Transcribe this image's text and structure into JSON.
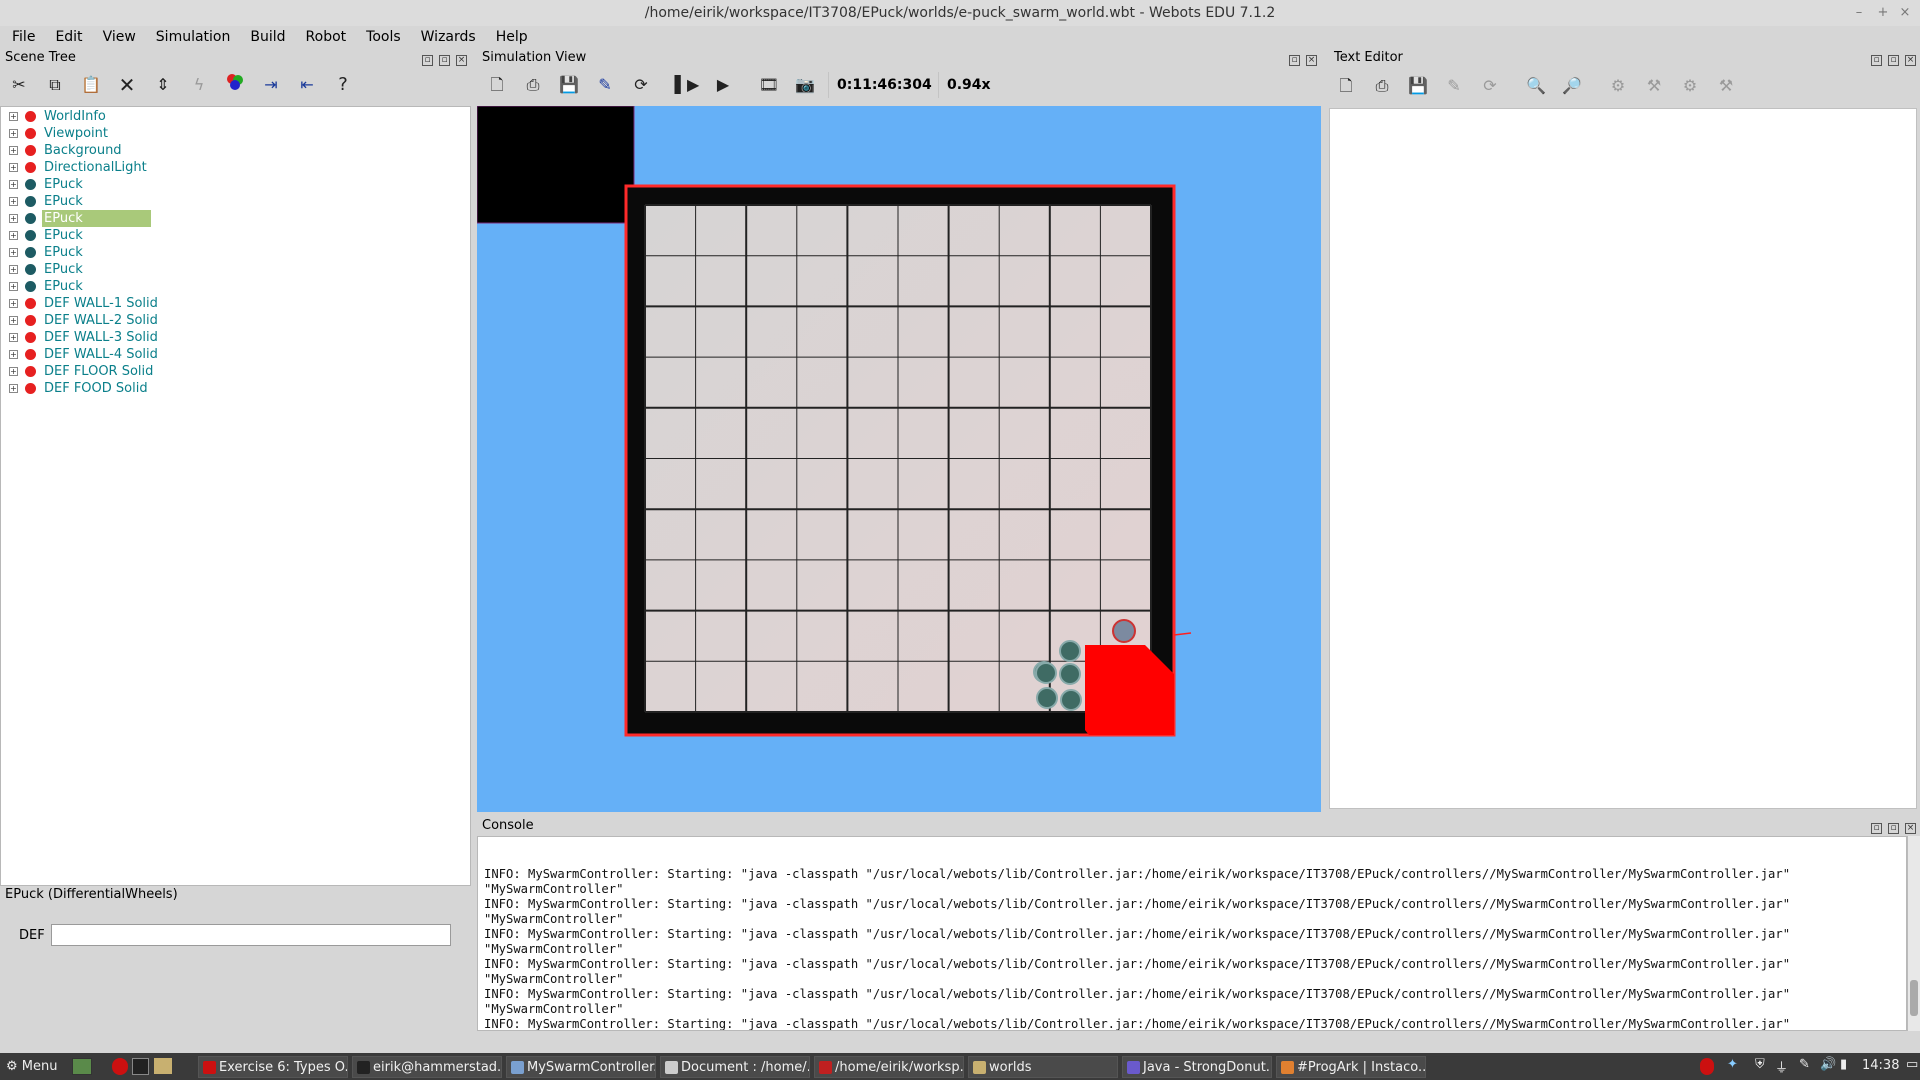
{
  "window": {
    "title": "/home/eirik/workspace/IT3708/EPuck/worlds/e-puck_swarm_world.wbt - Webots EDU 7.1.2"
  },
  "menubar": [
    "File",
    "Edit",
    "View",
    "Simulation",
    "Build",
    "Robot",
    "Tools",
    "Wizards",
    "Help"
  ],
  "scene_tree": {
    "title": "Scene Tree",
    "toolbar_icons": [
      "cut-icon",
      "copy-icon",
      "paste-icon",
      "delete-icon",
      "reset-value-icon",
      "transform-icon",
      "add-node-icon",
      "import-icon",
      "export-icon",
      "help-icon"
    ],
    "help_glyph": "?",
    "items": [
      {
        "label": "WorldInfo",
        "dot": "#e62020"
      },
      {
        "label": "Viewpoint",
        "dot": "#e62020"
      },
      {
        "label": "Background",
        "dot": "#e62020"
      },
      {
        "label": "DirectionalLight",
        "dot": "#e62020"
      },
      {
        "label": "EPuck",
        "dot": "#1d5b63"
      },
      {
        "label": "EPuck",
        "dot": "#1d5b63"
      },
      {
        "label": "EPuck",
        "dot": "#1d5b63",
        "selected": true
      },
      {
        "label": "EPuck",
        "dot": "#1d5b63"
      },
      {
        "label": "EPuck",
        "dot": "#1d5b63"
      },
      {
        "label": "EPuck",
        "dot": "#1d5b63"
      },
      {
        "label": "EPuck",
        "dot": "#1d5b63"
      },
      {
        "label": "DEF WALL-1 Solid",
        "dot": "#e62020"
      },
      {
        "label": "DEF WALL-2 Solid",
        "dot": "#e62020"
      },
      {
        "label": "DEF WALL-3 Solid",
        "dot": "#e62020"
      },
      {
        "label": "DEF WALL-4 Solid",
        "dot": "#e62020"
      },
      {
        "label": "DEF FLOOR Solid",
        "dot": "#e62020"
      },
      {
        "label": "DEF FOOD Solid",
        "dot": "#e62020"
      }
    ],
    "selection_label": "EPuck (DifferentialWheels)",
    "def_label": "DEF",
    "def_value": ""
  },
  "simulation_view": {
    "title": "Simulation View",
    "toolbar_icons": [
      "new-world-icon",
      "open-world-icon",
      "save-world-icon",
      "edit-icon",
      "reload-icon",
      "step-icon",
      "run-icon",
      "record-movie-icon",
      "screenshot-icon"
    ],
    "time": "0:11:46:304",
    "speed": "0.94x",
    "grid": {
      "cols": 10,
      "rows": 10
    },
    "colors": {
      "background": "#65b0f7",
      "wall": "#0a0a0a",
      "food": "#ff0000",
      "floor": "#d4d2d2",
      "wall_edge": "#ff2a2a"
    }
  },
  "text_editor": {
    "title": "Text Editor",
    "toolbar_icons": [
      "new-file-icon",
      "open-file-icon",
      "save-file-icon",
      "save-as-icon",
      "revert-icon",
      "find-icon",
      "replace-icon",
      "build-icon",
      "clean-icon",
      "make-icon",
      "broom-icon"
    ]
  },
  "console": {
    "title": "Console",
    "lines": [
      "INFO: MySwarmController: Starting: \"java -classpath \"/usr/local/webots/lib/Controller.jar:/home/eirik/workspace/IT3708/EPuck/controllers//MySwarmController/MySwarmController.jar\"",
      "\"MySwarmController\"",
      "INFO: MySwarmController: Starting: \"java -classpath \"/usr/local/webots/lib/Controller.jar:/home/eirik/workspace/IT3708/EPuck/controllers//MySwarmController/MySwarmController.jar\"",
      "\"MySwarmController\"",
      "INFO: MySwarmController: Starting: \"java -classpath \"/usr/local/webots/lib/Controller.jar:/home/eirik/workspace/IT3708/EPuck/controllers//MySwarmController/MySwarmController.jar\"",
      "\"MySwarmController\"",
      "INFO: MySwarmController: Starting: \"java -classpath \"/usr/local/webots/lib/Controller.jar:/home/eirik/workspace/IT3708/EPuck/controllers//MySwarmController/MySwarmController.jar\"",
      "\"MySwarmController\"",
      "INFO: MySwarmController: Starting: \"java -classpath \"/usr/local/webots/lib/Controller.jar:/home/eirik/workspace/IT3708/EPuck/controllers//MySwarmController/MySwarmController.jar\"",
      "\"MySwarmController\"",
      "INFO: MySwarmController: Starting: \"java -classpath \"/usr/local/webots/lib/Controller.jar:/home/eirik/workspace/IT3708/EPuck/controllers//MySwarmController/MySwarmController.jar\"",
      "\"MySwarmController\""
    ]
  },
  "taskbar": {
    "menu_label": "Menu",
    "tasks": [
      {
        "label": "Exercise 6: Types O...",
        "color": "#cc1010",
        "icon": "opera-icon"
      },
      {
        "label": "eirik@hammerstad...",
        "color": "#222",
        "icon": "terminal-icon"
      },
      {
        "label": "MySwarmController...",
        "color": "#7aa0d0",
        "icon": "cube-icon"
      },
      {
        "label": "Document : /home/...",
        "color": "#cccccc",
        "icon": "document-icon"
      },
      {
        "label": "/home/eirik/worksp...",
        "color": "#c02020",
        "icon": "webots-icon"
      },
      {
        "label": "worlds",
        "color": "#c8b070",
        "icon": "folder-icon"
      },
      {
        "label": "Java - StrongDonut...",
        "color": "#6a5acd",
        "icon": "eclipse-icon"
      },
      {
        "label": "#ProgArk | Instaco...",
        "color": "#e08030",
        "icon": "firefox-icon"
      }
    ],
    "clock": "14:38"
  }
}
